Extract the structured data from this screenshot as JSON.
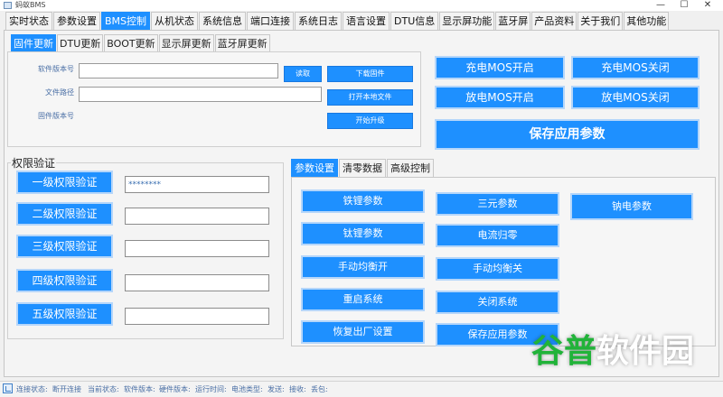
{
  "window": {
    "title": "蚂蚁BMS",
    "minimize": "—",
    "maximize": "☐",
    "close": "✕"
  },
  "main_tabs": [
    "实时状态",
    "参数设置",
    "BMS控制",
    "从机状态",
    "系统信息",
    "端口连接",
    "系统日志",
    "语言设置",
    "DTU信息",
    "显示屏功能",
    "蓝牙屏",
    "产品资料",
    "关于我们",
    "其他功能"
  ],
  "main_tab_active": 2,
  "sub_tabs": [
    "固件更新",
    "DTU更新",
    "BOOT更新",
    "显示屏更新",
    "蓝牙屏更新"
  ],
  "sub_tab_active": 0,
  "firmware": {
    "software_version_label": "软件版本号",
    "software_version_value": "",
    "read_button": "读取",
    "file_path_label": "文件路径",
    "file_path_value": "",
    "firmware_version_label": "固件版本号",
    "download_button": "下载固件",
    "open_file_button": "打开本地文件",
    "start_upgrade_button": "开始升级"
  },
  "mos": {
    "charge_on": "充电MOS开启",
    "charge_off": "充电MOS关闭",
    "discharge_on": "放电MOS开启",
    "discharge_off": "放电MOS关闭",
    "save_params": "保存应用参数"
  },
  "auth": {
    "legend": "权限验证",
    "levels": [
      {
        "label": "一级权限验证",
        "value": "********"
      },
      {
        "label": "二级权限验证",
        "value": ""
      },
      {
        "label": "三级权限验证",
        "value": ""
      },
      {
        "label": "四级权限验证",
        "value": ""
      },
      {
        "label": "五级权限验证",
        "value": ""
      }
    ]
  },
  "param_tabs": [
    "参数设置",
    "清零数据",
    "高级控制"
  ],
  "param_tab_active": 0,
  "param_buttons": {
    "ternary": "三元参数",
    "lifepo": "铁锂参数",
    "sodium": "钠电参数",
    "lto": "钛锂参数",
    "current_zero": "电流归零",
    "balance_on": "手动均衡开",
    "balance_off": "手动均衡关",
    "restart": "重启系统",
    "shutdown": "关闭系统",
    "factory_reset": "恢复出厂设置",
    "save_params": "保存应用参数"
  },
  "status_bar": {
    "connect_state": "连接状态:",
    "disconnect": "断开连接",
    "current_state": "当前状态:",
    "software_version": "软件版本:",
    "hardware_version": "硬件版本:",
    "run_time": "运行时间:",
    "cell_type": "电池类型:",
    "send": "发送:",
    "receive": "接收:",
    "lost_packets": "丢包:"
  },
  "watermark": {
    "part1": "谷普",
    "part2": "软件园"
  },
  "colors": {
    "accent": "#1e90ff",
    "watermark_green": "#21b339"
  }
}
